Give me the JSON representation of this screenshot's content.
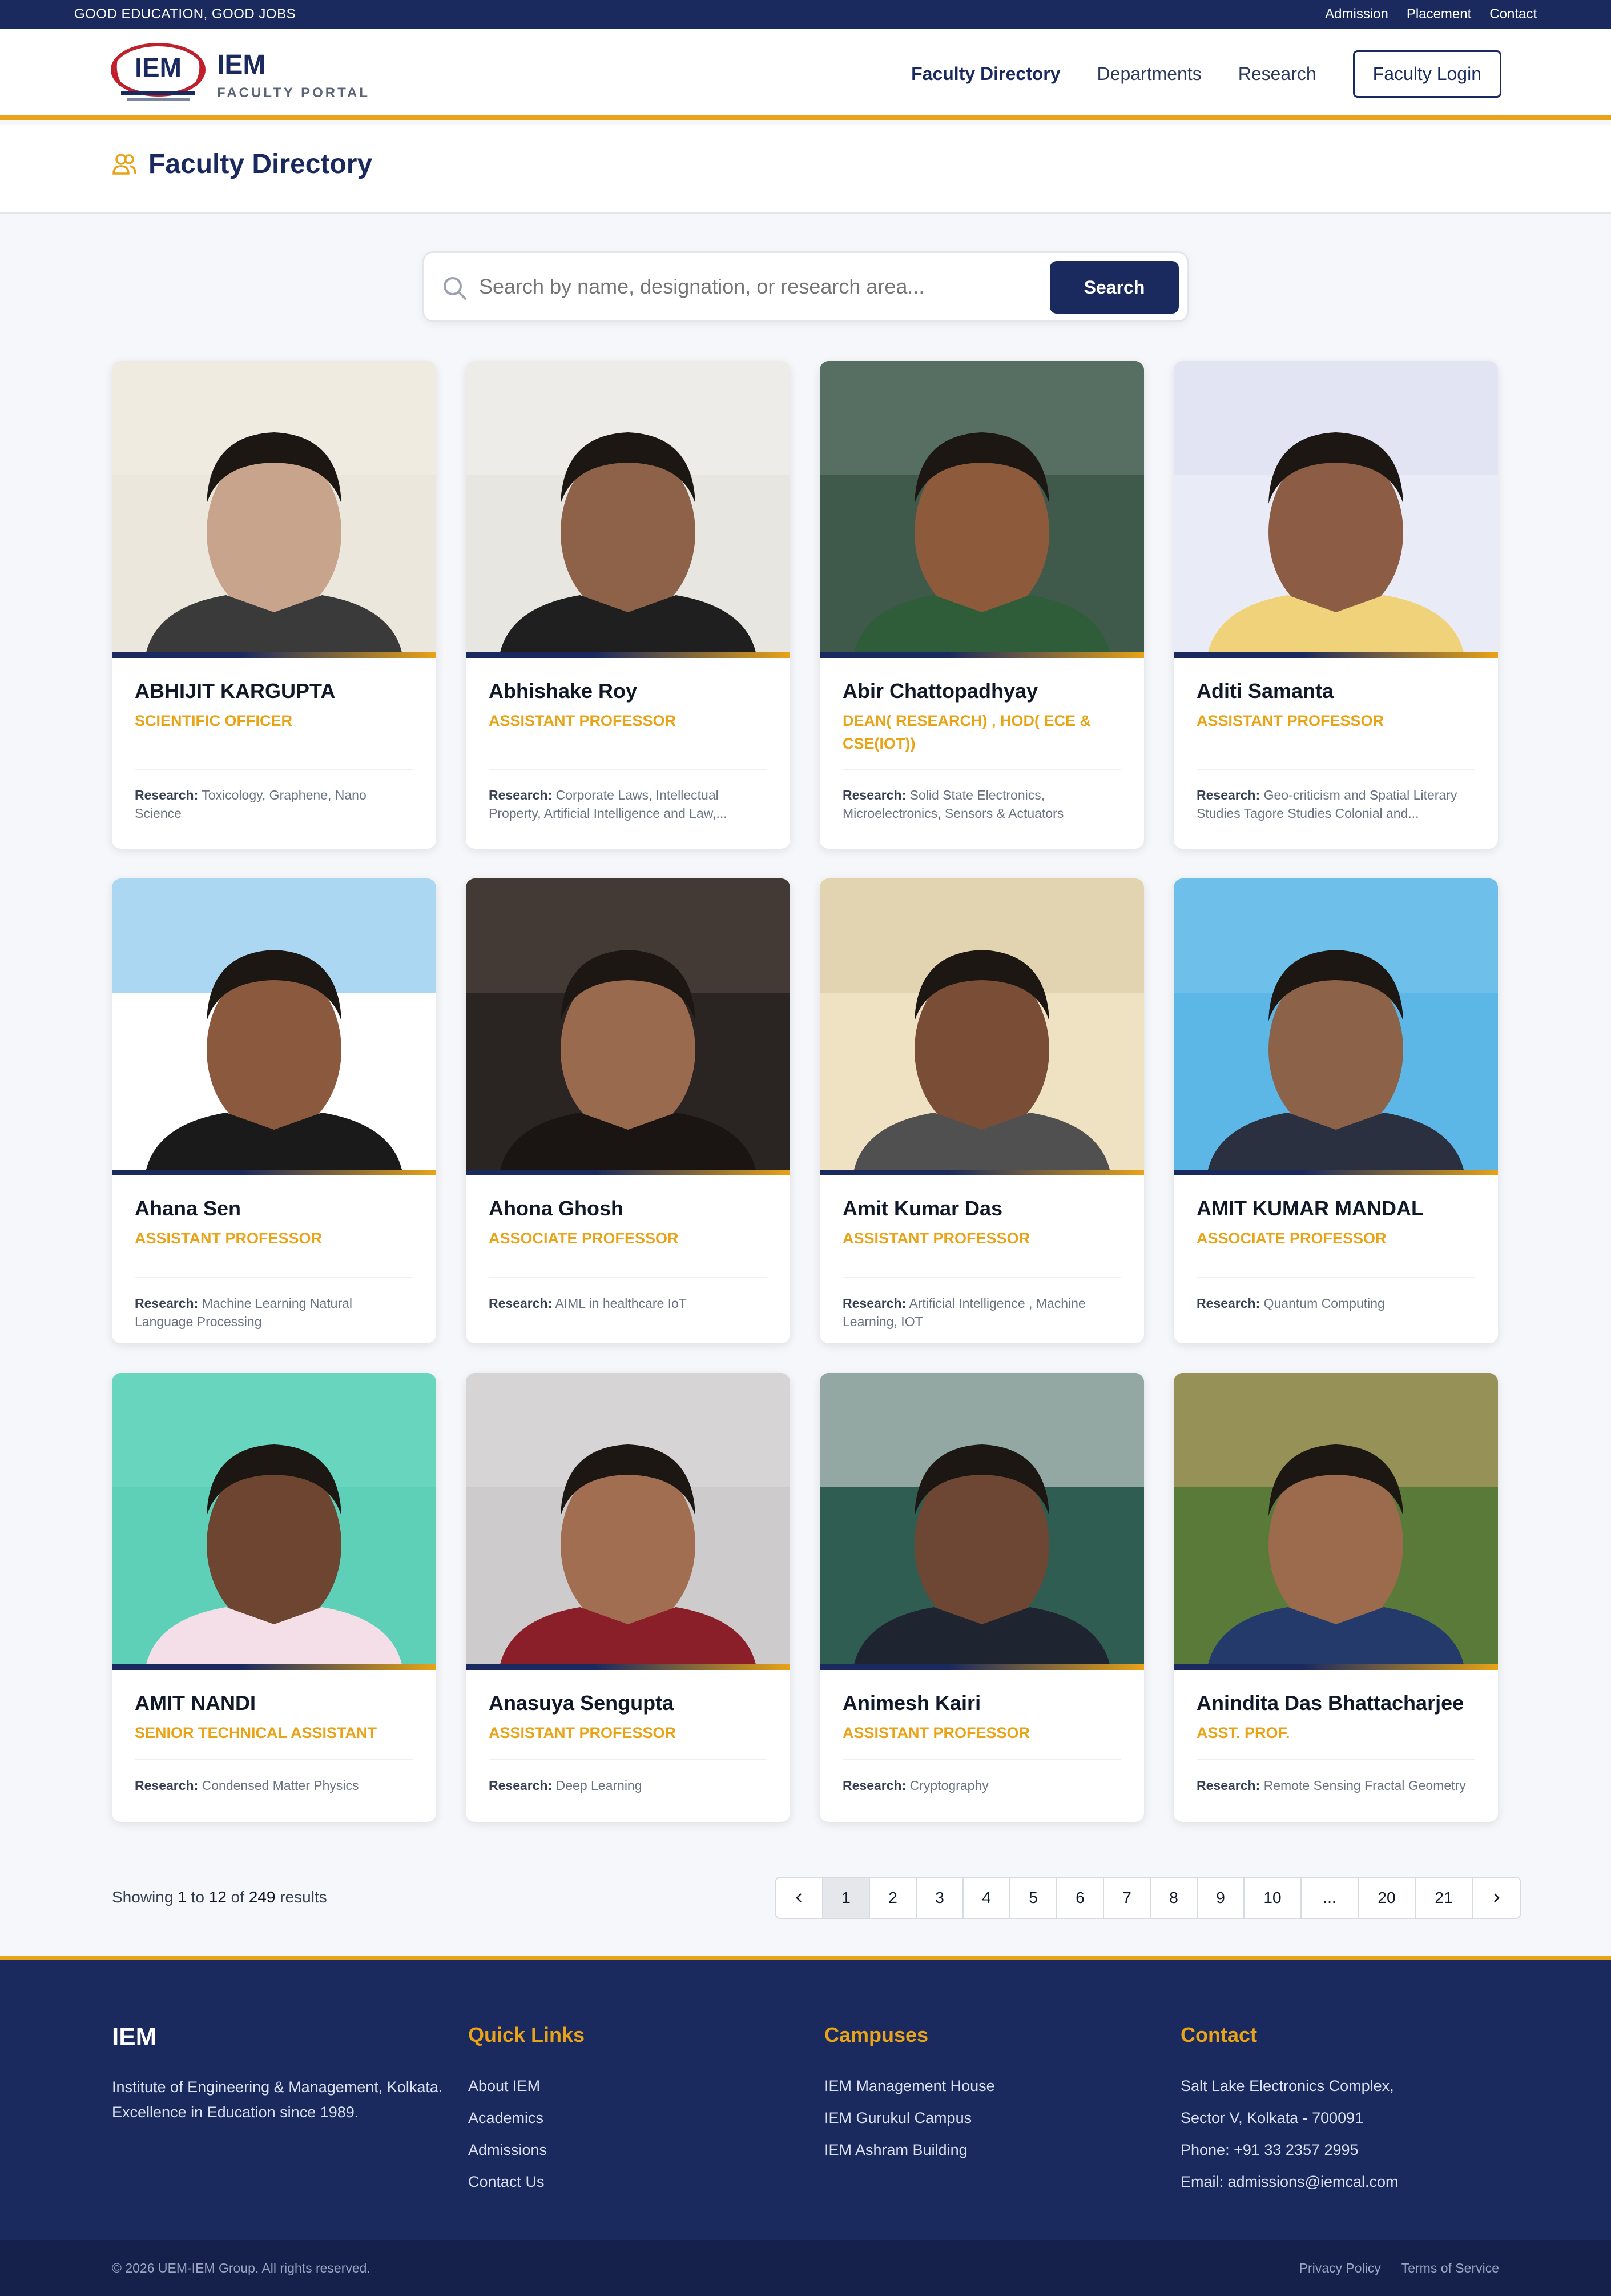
{
  "topbar": {
    "tagline": "GOOD EDUCATION, GOOD JOBS",
    "links": [
      "Admission",
      "Placement",
      "Contact"
    ]
  },
  "header": {
    "logo_text": "IEM",
    "brand_name": "IEM",
    "brand_sub": "FACULTY PORTAL",
    "nav": [
      "Faculty Directory",
      "Departments",
      "Research"
    ],
    "login": "Faculty Login",
    "colors": {
      "navy": "#1b2a5e",
      "accent": "#e8a317"
    }
  },
  "page": {
    "title": "Faculty Directory"
  },
  "search": {
    "placeholder": "Search by name, designation, or research area...",
    "button": "Search"
  },
  "research_label": "Research:",
  "faculty": [
    {
      "name": "ABHIJIT KARGUPTA",
      "designation": "SCIENTIFIC OFFICER",
      "research": "Toxicology, Graphene, Nano Science"
    },
    {
      "name": "Abhishake Roy",
      "designation": "ASSISTANT PROFESSOR",
      "research": "Corporate Laws, Intellectual Property, Artificial Intelligence and Law,..."
    },
    {
      "name": "Abir Chattopadhyay",
      "designation": "DEAN( RESEARCH) , HOD( ECE & CSE(IOT))",
      "research": "Solid State Electronics, Microelectronics, Sensors & Actuators"
    },
    {
      "name": "Aditi Samanta",
      "designation": "ASSISTANT PROFESSOR",
      "research": "Geo-criticism and Spatial Literary Studies Tagore Studies Colonial and..."
    },
    {
      "name": "Ahana Sen",
      "designation": "ASSISTANT PROFESSOR",
      "research": "Machine Learning Natural Language Processing"
    },
    {
      "name": "Ahona Ghosh",
      "designation": "ASSOCIATE PROFESSOR",
      "research": "AIML in healthcare IoT"
    },
    {
      "name": "Amit Kumar Das",
      "designation": "ASSISTANT PROFESSOR",
      "research": "Artificial Intelligence , Machine Learning, IOT"
    },
    {
      "name": "AMIT KUMAR MANDAL",
      "designation": "ASSOCIATE PROFESSOR",
      "research": "Quantum Computing"
    },
    {
      "name": "AMIT NANDI",
      "designation": "SENIOR TECHNICAL ASSISTANT",
      "research": "Condensed Matter Physics"
    },
    {
      "name": "Anasuya Sengupta",
      "designation": "ASSISTANT PROFESSOR",
      "research": "Deep Learning"
    },
    {
      "name": "Animesh Kairi",
      "designation": "ASSISTANT PROFESSOR",
      "research": "Cryptography"
    },
    {
      "name": "Anindita Das Bhattacharjee",
      "designation": "ASST. PROF.",
      "research": "Remote Sensing Fractal Geometry"
    }
  ],
  "results": {
    "prefix": "Showing",
    "from": "1",
    "to_word": "to",
    "to": "12",
    "of_word": "of",
    "total": "249",
    "suffix": "results"
  },
  "pagination": {
    "pages": [
      "1",
      "2",
      "3",
      "4",
      "5",
      "6",
      "7",
      "8",
      "9",
      "10",
      "...",
      "20",
      "21"
    ],
    "current": "1"
  },
  "footer": {
    "brand": "IEM",
    "description": "Institute of Engineering & Management, Kolkata. Excellence in Education since 1989.",
    "quick_links": {
      "title": "Quick Links",
      "items": [
        "About IEM",
        "Academics",
        "Admissions",
        "Contact Us"
      ]
    },
    "campuses": {
      "title": "Campuses",
      "items": [
        "IEM Management House",
        "IEM Gurukul Campus",
        "IEM Ashram Building"
      ]
    },
    "contact": {
      "title": "Contact",
      "items": [
        "Salt Lake Electronics Complex,",
        "Sector V, Kolkata - 700091",
        "Phone: +91 33 2357 2995",
        "Email: admissions@iemcal.com"
      ]
    },
    "copyright": "© 2026 UEM-IEM Group. All rights reserved.",
    "legal": [
      "Privacy Policy",
      "Terms of Service"
    ]
  }
}
